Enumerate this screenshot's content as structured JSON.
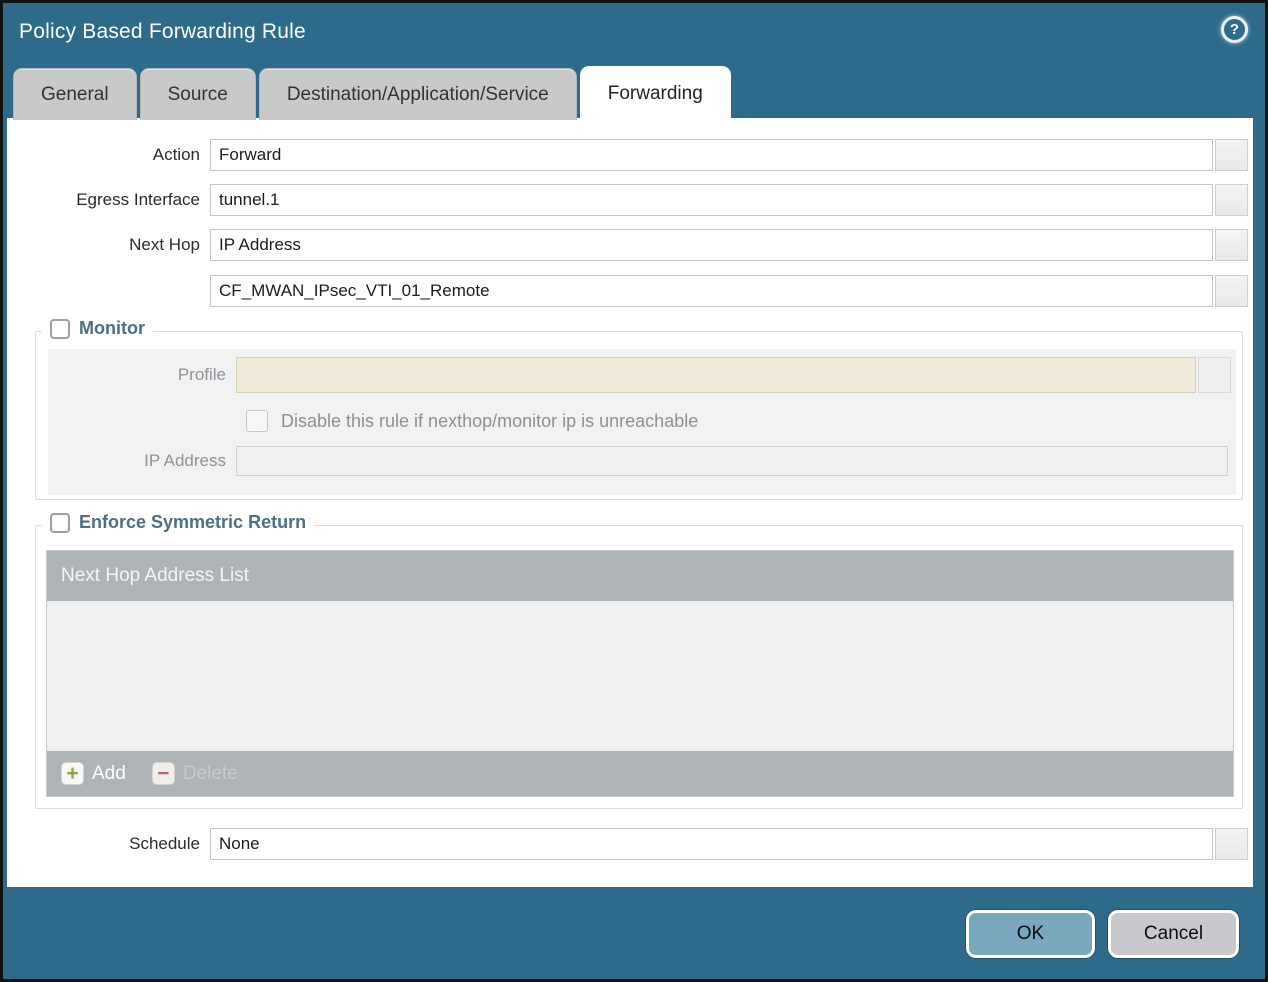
{
  "window": {
    "title": "Policy Based Forwarding Rule",
    "help_icon": "?",
    "colors": {
      "chrome": "#2e6b8a",
      "content": "#ffffff",
      "accent_legend": "#4e6e84",
      "ok_button": "#79a7bd",
      "cancel_button": "#c9c9cd",
      "disabled_field": "#f1ecd9",
      "list_chrome": "#aeb3b5"
    }
  },
  "tabs": [
    {
      "label": "General",
      "active": false
    },
    {
      "label": "Source",
      "active": false
    },
    {
      "label": "Destination/Application/Service",
      "active": false
    },
    {
      "label": "Forwarding",
      "active": true
    }
  ],
  "form": {
    "action": {
      "label": "Action",
      "value": "Forward"
    },
    "egress_interface": {
      "label": "Egress Interface",
      "value": "tunnel.1"
    },
    "next_hop": {
      "label": "Next Hop",
      "value": "IP Address"
    },
    "next_hop_address": {
      "value": "CF_MWAN_IPsec_VTI_01_Remote"
    },
    "schedule": {
      "label": "Schedule",
      "value": "None"
    }
  },
  "monitor": {
    "legend": "Monitor",
    "checked": false,
    "profile": {
      "label": "Profile",
      "value": ""
    },
    "disable_checkbox_label": "Disable this rule if nexthop/monitor ip is unreachable",
    "disable_checked": false,
    "ip_address": {
      "label": "IP Address",
      "value": ""
    }
  },
  "symmetric_return": {
    "legend": "Enforce Symmetric Return",
    "checked": false,
    "list_header": "Next Hop Address List",
    "rows": [],
    "add_label": "Add",
    "delete_label": "Delete"
  },
  "footer": {
    "ok_label": "OK",
    "cancel_label": "Cancel"
  }
}
